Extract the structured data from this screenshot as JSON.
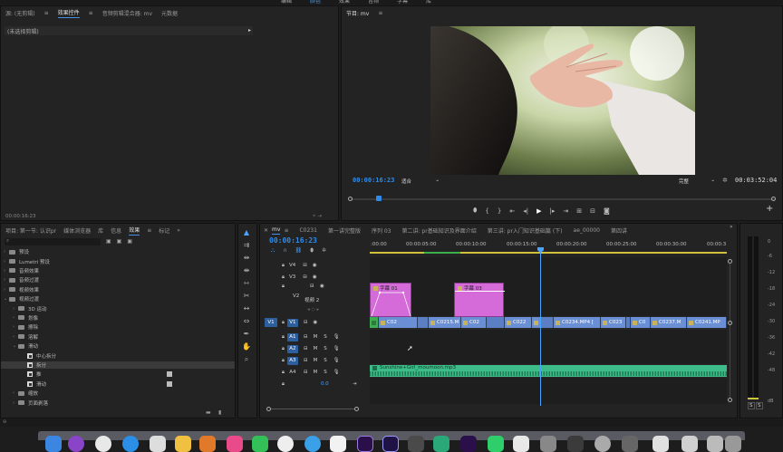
{
  "top_menu": [
    "编辑",
    "颜色",
    "效果",
    "音频",
    "字幕",
    "库"
  ],
  "source_panel": {
    "tab_source": "源: (无剪辑)",
    "tab_effect_controls": "效果控件",
    "tab_audio_mixer": "音频剪辑混合器: mv",
    "tab_metadata": "元数据",
    "no_clip_text": "(未选择剪辑)",
    "timecode": "00:00:16:23"
  },
  "program_monitor": {
    "title": "节目: mv",
    "timecode": "00:00:16:23",
    "fit_label": "适合",
    "quality_label": "完整",
    "duration": "00:03:52:04",
    "playhead_fraction": 0.07
  },
  "project_panel": {
    "tabs": [
      "项目: 第一节: 认识pr",
      "媒体浏览器",
      "库",
      "信息",
      "效果",
      "标记"
    ],
    "active_tab": "效果",
    "items": [
      {
        "label": "预设",
        "indent": 0,
        "type": "folder",
        "tri": "›"
      },
      {
        "label": "Lumetri 预设",
        "indent": 0,
        "type": "folder",
        "tri": "›"
      },
      {
        "label": "音频效果",
        "indent": 0,
        "type": "folder",
        "tri": "›"
      },
      {
        "label": "音频过渡",
        "indent": 0,
        "type": "folder",
        "tri": "›"
      },
      {
        "label": "视频效果",
        "indent": 0,
        "type": "folder",
        "tri": "›"
      },
      {
        "label": "视频过渡",
        "indent": 0,
        "type": "folder",
        "tri": "⌄"
      },
      {
        "label": "3D 运动",
        "indent": 1,
        "type": "folder",
        "tri": "›"
      },
      {
        "label": "划像",
        "indent": 1,
        "type": "folder",
        "tri": "›"
      },
      {
        "label": "擦除",
        "indent": 1,
        "type": "folder",
        "tri": "›"
      },
      {
        "label": "溶解",
        "indent": 1,
        "type": "folder",
        "tri": "›"
      },
      {
        "label": "滑动",
        "indent": 1,
        "type": "folder",
        "tri": "⌄"
      },
      {
        "label": "中心拆分",
        "indent": 2,
        "type": "fx",
        "tri": ""
      },
      {
        "label": "拆分",
        "indent": 2,
        "type": "fx",
        "tri": "",
        "selected": true
      },
      {
        "label": "推",
        "indent": 2,
        "type": "fx",
        "tri": "",
        "badge": true
      },
      {
        "label": "滑动",
        "indent": 2,
        "type": "fx",
        "tri": "",
        "badge": true
      },
      {
        "label": "缩放",
        "indent": 1,
        "type": "folder",
        "tri": "›"
      },
      {
        "label": "页面剥落",
        "indent": 1,
        "type": "folder",
        "tri": "›"
      }
    ]
  },
  "timeline": {
    "tabs": [
      "mv",
      "C0231",
      "第一讲完整版",
      "序列 03",
      "第二讲: pr基础知识及界面介绍",
      "第三讲: pr入门知识基础篇 (下)",
      "ae_00000",
      "第四讲"
    ],
    "timecode": "00:00:16:23",
    "ruler": [
      ":00:00",
      "00:00:05:00",
      "00:00:10:00",
      "00:00:15:00",
      "00:00:20:00",
      "00:00:25:00",
      "00:00:30:00",
      "00:00:3"
    ],
    "tracks": {
      "v4": "V4",
      "v3": "V3",
      "v2": "V2",
      "v2_name": "视频 2",
      "v1": "V1",
      "v1_src": "V1",
      "a1": "A1",
      "a2": "A2",
      "a3": "A3",
      "a4": "A4",
      "a1_src": "A1",
      "mix_val": "0.0",
      "m": "M",
      "s": "S"
    },
    "title_clips": [
      "字幕 01",
      "字幕 03"
    ],
    "video_clips": [
      "C02",
      "C0215.M",
      "C02",
      "C022",
      "C0234.MP4 [",
      "C023",
      "C0",
      "C0237.M",
      "C0241.MP"
    ],
    "audio_clip": "Sunshine+Girl_moumoon.mp3"
  },
  "audio_meter": {
    "scale": [
      "0",
      "-6",
      "-12",
      "-18",
      "-24",
      "-30",
      "-36",
      "-42",
      "-48",
      "dB"
    ],
    "solo": [
      "S",
      "S"
    ]
  },
  "colors": {
    "accent": "#2d8ceb",
    "title_clip": "#d46bd8",
    "video_clip": "#6b8fd4",
    "audio_clip": "#3dbb88"
  }
}
